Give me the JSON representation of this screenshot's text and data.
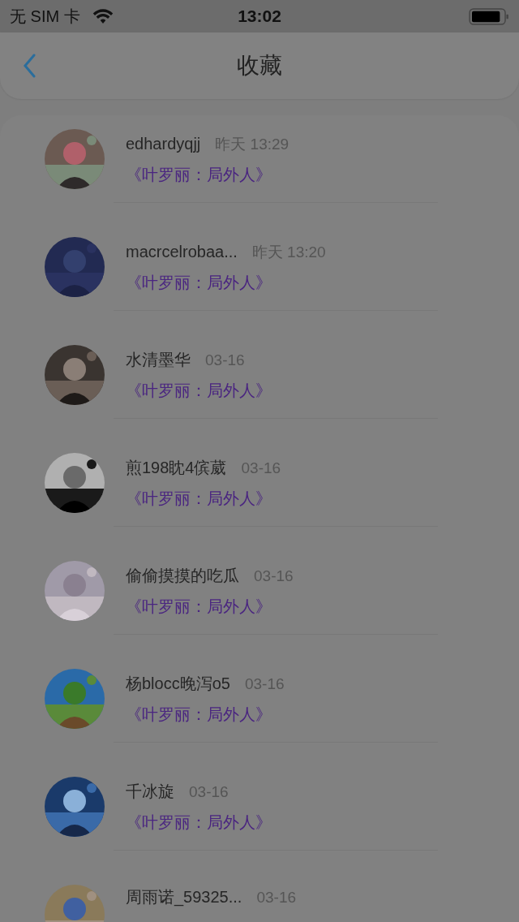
{
  "status_bar": {
    "carrier": "无 SIM 卡",
    "time": "13:02"
  },
  "nav": {
    "title": "收藏"
  },
  "items": [
    {
      "name": "edhardyqjj",
      "time": "昨天 13:29",
      "book": "《叶罗丽：局外人》"
    },
    {
      "name": "macrcelrobaa...",
      "time": "昨天 13:20",
      "book": "《叶罗丽：局外人》"
    },
    {
      "name": "水清墨华",
      "time": "03-16",
      "book": "《叶罗丽：局外人》"
    },
    {
      "name": "煎198眈4傧葳",
      "time": "03-16",
      "book": "《叶罗丽：局外人》"
    },
    {
      "name": "偷偷摸摸的吃瓜",
      "time": "03-16",
      "book": "《叶罗丽：局外人》"
    },
    {
      "name": "杨blocc晚泻o5",
      "time": "03-16",
      "book": "《叶罗丽：局外人》"
    },
    {
      "name": "千冰旋",
      "time": "03-16",
      "book": "《叶罗丽：局外人》"
    },
    {
      "name": "周雨诺_59325...",
      "time": "03-16"
    }
  ]
}
